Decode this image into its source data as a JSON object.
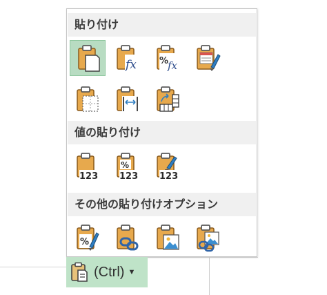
{
  "menu": {
    "sections": [
      {
        "title": "貼り付け",
        "icons": [
          "paste-icon",
          "paste-formula-icon",
          "paste-formula-number-format-icon",
          "paste-keep-source-formatting-icon",
          "paste-no-borders-icon",
          "paste-keep-column-widths-icon",
          "paste-transpose-icon"
        ]
      },
      {
        "title": "値の貼り付け",
        "icons": [
          "paste-values-icon",
          "paste-values-number-format-icon",
          "paste-values-source-formatting-icon"
        ]
      },
      {
        "title": "その他の貼り付けオプション",
        "icons": [
          "paste-formatting-icon",
          "paste-link-icon",
          "paste-picture-icon",
          "paste-linked-picture-icon"
        ]
      }
    ],
    "value_badge": "123",
    "fx_glyph": "fx",
    "percent_glyph": "%"
  },
  "ctrl_button": {
    "label": "(Ctrl)",
    "icon": "clipboard-icon",
    "chevron": "chevron-down-icon"
  },
  "colors": {
    "selected_bg": "#b8dcc2",
    "header_bg": "#f0f0f0",
    "clipboard_body": "#e7a94d",
    "clipboard_clip": "#5a5a5a",
    "ctrl_bg": "#bfe3c8"
  }
}
